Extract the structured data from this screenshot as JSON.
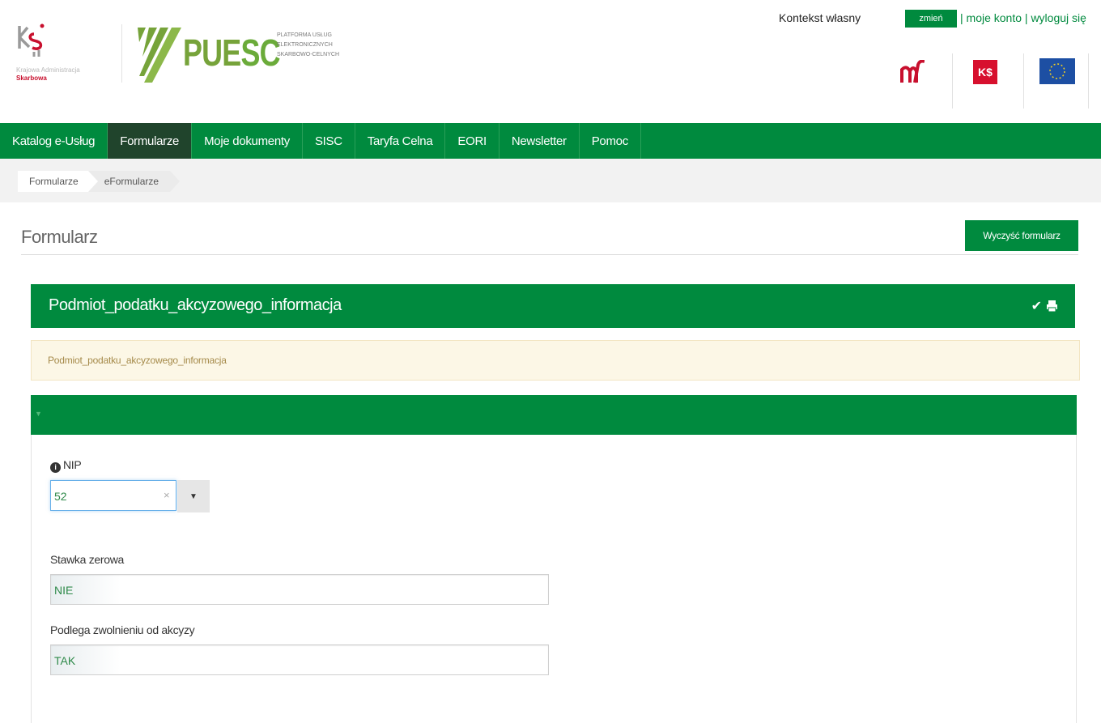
{
  "header": {
    "kas": {
      "line1": "Krajowa Administracja",
      "line2": "Skarbowa"
    },
    "puesc": {
      "name_a": "PUE",
      "name_b": "SC",
      "tagline": [
        "PLATFORMA USŁUG",
        "ELEKTRONICZNYCH",
        "SKARBOWO-CELNYCH"
      ]
    },
    "context_label": "Kontekst własny",
    "change_button": "zmień",
    "my_account_link": "moje konto",
    "logout_link": "wyloguj się",
    "separator": "|",
    "partner_logos": [
      "mf-logo",
      "kas-logo",
      "eu-flag"
    ]
  },
  "nav": {
    "items": [
      {
        "label": "Katalog e-Usług",
        "active": false
      },
      {
        "label": "Formularze",
        "active": true
      },
      {
        "label": "Moje dokumenty",
        "active": false
      },
      {
        "label": "SISC",
        "active": false
      },
      {
        "label": "Taryfa Celna",
        "active": false
      },
      {
        "label": "EORI",
        "active": false
      },
      {
        "label": "Newsletter",
        "active": false
      },
      {
        "label": "Pomoc",
        "active": false
      }
    ]
  },
  "breadcrumb": [
    "Formularze",
    "eFormularze"
  ],
  "form": {
    "title": "Formularz",
    "clear_button": "Wyczyść formularz",
    "section_title": "Podmiot_podatku_akcyzowego_informacja",
    "section_icons": [
      "check-icon",
      "print-icon"
    ],
    "info_text": "Podmiot_podatku_akcyzowego_informacja",
    "fields": {
      "nip": {
        "label": "NIP",
        "value": "52"
      },
      "stawka": {
        "label": "Stawka zerowa",
        "value": "NIE"
      },
      "zwolnienie": {
        "label": "Podlega zwolnieniu od akcyzy",
        "value": "TAK"
      }
    }
  },
  "colors": {
    "brand_green": "#008a3e",
    "nav_active": "#20442c",
    "info_bg": "#fcf7e6"
  }
}
